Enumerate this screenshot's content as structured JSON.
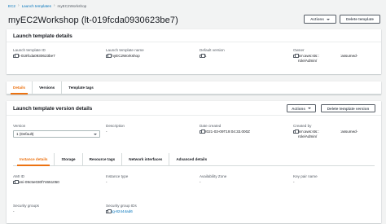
{
  "breadcrumb": {
    "items": [
      "EC2",
      "Launch templates",
      "myEC2Workshop"
    ]
  },
  "header": {
    "title": "myEC2Workshop (lt-019fcda0930623be7)",
    "actions_label": "Actions",
    "delete_label": "Delete template"
  },
  "details_panel": {
    "title": "Launch template details",
    "fields": [
      {
        "label": "Launch template ID",
        "value": "lt-019fcda0930623be7"
      },
      {
        "label": "Launch template name",
        "value": "myEC2Workshop"
      },
      {
        "label": "Default version",
        "value": "1"
      },
      {
        "label": "Owner",
        "value_line1": "arn:aws:sts::",
        "value_line1b": ":assumed-",
        "value_line2": "role/Admin/"
      }
    ]
  },
  "main_tabs": [
    "Details",
    "Versions",
    "Template tags"
  ],
  "version_panel": {
    "title": "Launch template version details",
    "actions_label": "Actions",
    "delete_label": "Delete template version",
    "version_label": "Version",
    "version_value": "1 (Default)",
    "description_label": "Description",
    "description_value": "-",
    "date_label": "Date created",
    "date_value": "2021-03-09T19:04:33.000Z",
    "created_by_label": "Created by",
    "created_by_line1": "arn:aws:sts::",
    "created_by_line1b": ":assumed-",
    "created_by_line2": "role/Admin/"
  },
  "sub_tabs": [
    "Instance details",
    "Storage",
    "Resource tags",
    "Network interfaces",
    "Advanced details"
  ],
  "instance_fields": [
    {
      "label": "AMI ID",
      "value": "ami-09c5e030f74651050",
      "copy": true
    },
    {
      "label": "Instance type",
      "value": "-",
      "copy": false
    },
    {
      "label": "Availability Zone",
      "value": "-",
      "copy": false
    },
    {
      "label": "Key pair name",
      "value": "-",
      "copy": false
    },
    {
      "label": "Security groups",
      "value": "-",
      "copy": false
    },
    {
      "label": "Security group IDs",
      "value": "sg-82444ad6",
      "copy": true
    }
  ]
}
